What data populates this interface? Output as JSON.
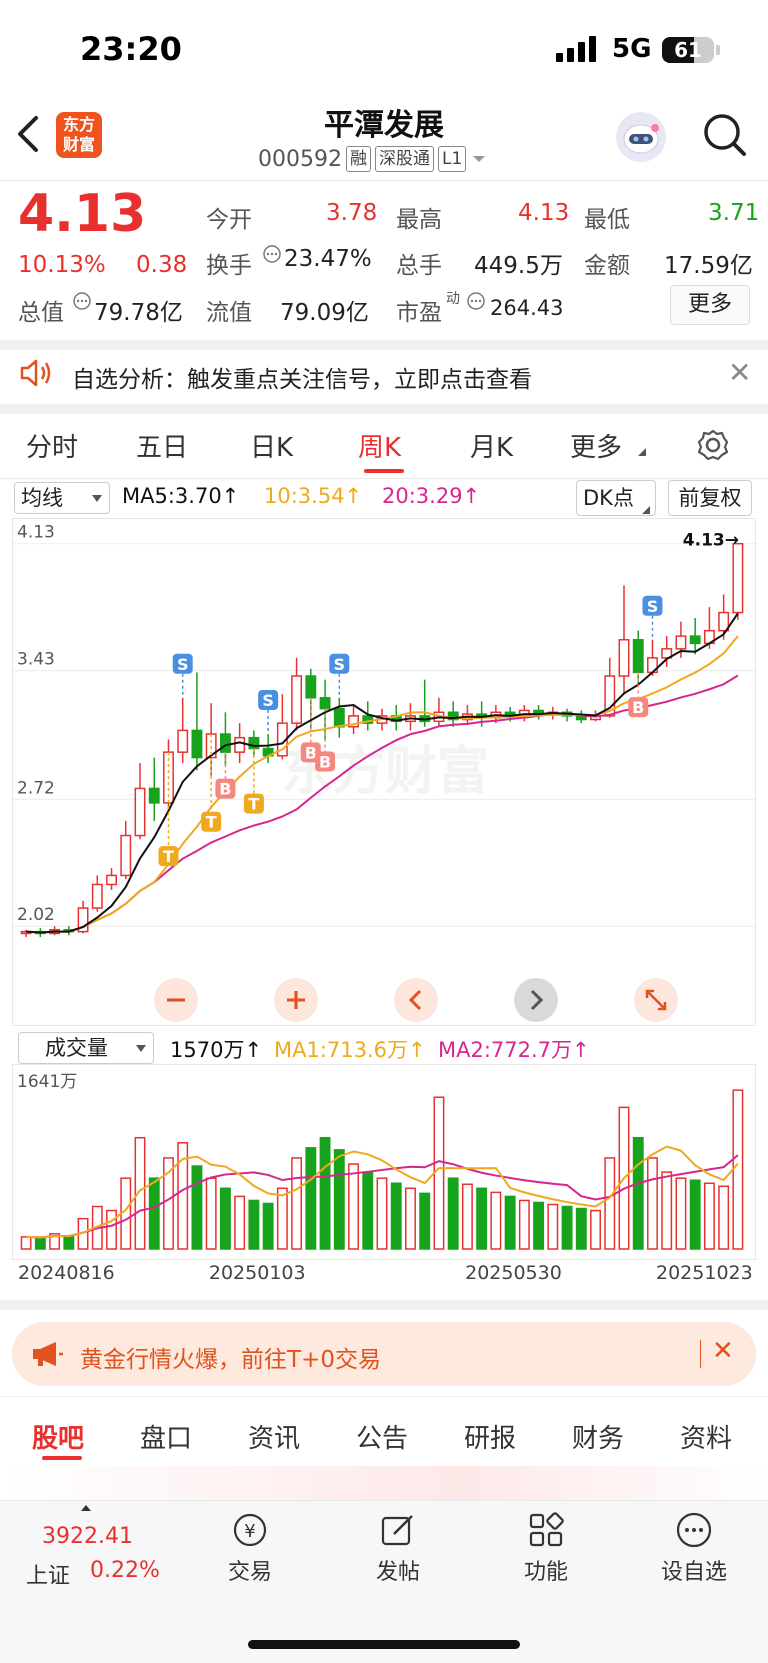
{
  "status_bar": {
    "time": "23:20",
    "network": "5G",
    "battery": "61",
    "battery_level": 0.61
  },
  "header": {
    "logo_text": "东方财富",
    "title": "平潭发展",
    "code": "000592",
    "tags": [
      "融",
      "深股通",
      "L1"
    ]
  },
  "quote": {
    "price": "4.13",
    "change_pct": "10.13%",
    "change_abs": "0.38",
    "fields": {
      "open_label": "今开",
      "open": "3.78",
      "high_label": "最高",
      "high": "4.13",
      "low_label": "最低",
      "low": "3.71",
      "turnover_label": "换手",
      "turnover": "23.47%",
      "volume_label": "总手",
      "volume": "449.5万",
      "amount_label": "金额",
      "amount": "17.59亿",
      "mktcap_label": "总值",
      "mktcap": "79.78亿",
      "float_label": "流值",
      "float": "79.09亿",
      "pe_label": "市盈",
      "pe_sup": "动",
      "pe": "264.43"
    },
    "more_label": "更多"
  },
  "alert": {
    "text": "自选分析：触发重点关注信号，立即点击查看"
  },
  "kline_tabs": {
    "items": [
      "分时",
      "五日",
      "日K",
      "周K",
      "月K",
      "更多"
    ],
    "active": "周K"
  },
  "chart_controls": {
    "ma_select": "均线",
    "ma5": "MA5:3.70↑",
    "ma10": "10:3.54↑",
    "ma20": "20:3.29↑",
    "dk_select": "DK点",
    "adjust": "前复权",
    "vol_select": "成交量",
    "vol_value": "1570万↑",
    "vol_ma1": "MA1:713.6万↑",
    "vol_ma2": "MA2:772.7万↑"
  },
  "colors": {
    "up": "#e8312f",
    "down": "#17a31c",
    "ma5": "#111111",
    "ma10": "#f0a81e",
    "ma20": "#d6268f"
  },
  "chart_data": {
    "type": "candlestick",
    "y_ticks": [
      "4.13",
      "3.43",
      "2.72",
      "2.02"
    ],
    "ylim": [
      1.85,
      4.2
    ],
    "last_price_label": "4.13→",
    "x_ticks": [
      "20240816",
      "20250103",
      "20250530",
      "20251023"
    ],
    "vol_max_label": "1641万",
    "vol_max": 1641,
    "markers": [
      {
        "label": "S",
        "i": 11
      },
      {
        "label": "T",
        "i": 10
      },
      {
        "label": "T",
        "i": 13
      },
      {
        "label": "B",
        "i": 14
      },
      {
        "label": "S",
        "i": 17
      },
      {
        "label": "T",
        "i": 16
      },
      {
        "label": "B",
        "i": 20
      },
      {
        "label": "B",
        "i": 21
      },
      {
        "label": "S",
        "i": 22
      },
      {
        "label": "S",
        "i": 44
      },
      {
        "label": "B",
        "i": 43
      }
    ],
    "candles": [
      [
        1.98,
        1.99,
        1.96,
        2.0
      ],
      [
        1.99,
        1.98,
        1.96,
        2.01
      ],
      [
        1.98,
        2.0,
        1.97,
        2.02
      ],
      [
        2.0,
        1.99,
        1.97,
        2.02
      ],
      [
        1.99,
        2.12,
        1.98,
        2.16
      ],
      [
        2.12,
        2.25,
        2.1,
        2.3
      ],
      [
        2.25,
        2.3,
        2.22,
        2.34
      ],
      [
        2.3,
        2.52,
        2.28,
        2.6
      ],
      [
        2.52,
        2.78,
        2.5,
        2.92
      ],
      [
        2.78,
        2.7,
        2.6,
        2.95
      ],
      [
        2.7,
        2.98,
        2.66,
        3.05
      ],
      [
        2.98,
        3.1,
        2.92,
        3.28
      ],
      [
        3.1,
        2.95,
        2.88,
        3.42
      ],
      [
        2.95,
        3.08,
        2.85,
        3.25
      ],
      [
        3.08,
        2.98,
        2.9,
        3.2
      ],
      [
        2.98,
        3.06,
        2.92,
        3.14
      ],
      [
        3.06,
        3.0,
        2.95,
        3.1
      ],
      [
        3.0,
        2.96,
        2.92,
        3.08
      ],
      [
        2.96,
        3.14,
        2.94,
        3.3
      ],
      [
        3.14,
        3.4,
        3.1,
        3.5
      ],
      [
        3.4,
        3.28,
        3.1,
        3.44
      ],
      [
        3.28,
        3.22,
        3.05,
        3.38
      ],
      [
        3.22,
        3.12,
        3.06,
        3.28
      ],
      [
        3.12,
        3.18,
        3.08,
        3.24
      ],
      [
        3.18,
        3.14,
        3.1,
        3.26
      ],
      [
        3.14,
        3.18,
        3.1,
        3.22
      ],
      [
        3.18,
        3.15,
        3.1,
        3.24
      ],
      [
        3.15,
        3.18,
        3.1,
        3.25
      ],
      [
        3.18,
        3.15,
        3.12,
        3.38
      ],
      [
        3.15,
        3.2,
        3.12,
        3.28
      ],
      [
        3.2,
        3.16,
        3.12,
        3.26
      ],
      [
        3.16,
        3.19,
        3.13,
        3.24
      ],
      [
        3.19,
        3.17,
        3.12,
        3.26
      ],
      [
        3.17,
        3.2,
        3.14,
        3.24
      ],
      [
        3.2,
        3.18,
        3.15,
        3.23
      ],
      [
        3.18,
        3.21,
        3.15,
        3.24
      ],
      [
        3.21,
        3.19,
        3.16,
        3.24
      ],
      [
        3.19,
        3.2,
        3.16,
        3.23
      ],
      [
        3.2,
        3.18,
        3.15,
        3.22
      ],
      [
        3.18,
        3.16,
        3.14,
        3.21
      ],
      [
        3.16,
        3.18,
        3.15,
        3.21
      ],
      [
        3.18,
        3.4,
        3.17,
        3.5
      ],
      [
        3.4,
        3.6,
        3.3,
        3.9
      ],
      [
        3.6,
        3.42,
        3.35,
        3.65
      ],
      [
        3.42,
        3.5,
        3.4,
        3.6
      ],
      [
        3.5,
        3.55,
        3.45,
        3.62
      ],
      [
        3.55,
        3.62,
        3.5,
        3.7
      ],
      [
        3.62,
        3.58,
        3.52,
        3.72
      ],
      [
        3.58,
        3.65,
        3.55,
        3.78
      ],
      [
        3.65,
        3.75,
        3.6,
        3.85
      ],
      [
        3.75,
        4.13,
        3.71,
        4.13
      ]
    ],
    "volumes": [
      120,
      110,
      150,
      130,
      300,
      420,
      380,
      700,
      1100,
      700,
      900,
      1050,
      820,
      700,
      600,
      520,
      480,
      450,
      600,
      900,
      1000,
      1100,
      980,
      840,
      760,
      700,
      650,
      600,
      550,
      1500,
      700,
      640,
      600,
      560,
      520,
      480,
      460,
      440,
      420,
      400,
      380,
      900,
      1400,
      1100,
      900,
      760,
      700,
      680,
      650,
      620,
      1570
    ]
  },
  "banner": {
    "text": "黄金行情火爆，前往T+0交易"
  },
  "bottom_tabs": {
    "items": [
      "股吧",
      "盘口",
      "资讯",
      "公告",
      "研报",
      "财务",
      "资料"
    ],
    "active": "股吧"
  },
  "bottom_nav": {
    "index_value": "3922.41",
    "index_name": "上证",
    "index_change": "0.22%",
    "items": [
      "交易",
      "发帖",
      "功能",
      "设自选"
    ]
  }
}
